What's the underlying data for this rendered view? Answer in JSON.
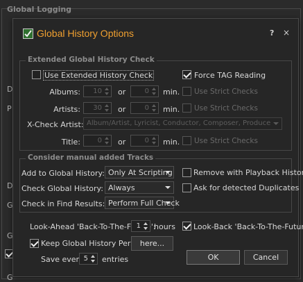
{
  "background": {
    "group1_title": "Global Logging",
    "side_letters": [
      "D",
      "P",
      "D",
      "G",
      "Gl",
      "G"
    ]
  },
  "dialog": {
    "title": "Global History Options",
    "help_glyph": "?",
    "close_glyph": "×",
    "icon": "checkmark-icon",
    "accent_color": "#f0a030"
  },
  "extended": {
    "group_title": "Extended Global History Check",
    "use_extended": {
      "label": "Use Extended History Check",
      "checked": false
    },
    "force_tag": {
      "label": "Force TAG Reading",
      "checked": true
    },
    "or_label": "or",
    "min_label": "min.",
    "rows": [
      {
        "label": "Albums:",
        "value_a": "10",
        "value_b": "0",
        "strict_label": "Use Strict Checks"
      },
      {
        "label": "Artists:",
        "value_a": "30",
        "value_b": "0",
        "strict_label": "Use Strict Checks"
      },
      {
        "label": "Title:",
        "value_a": "0",
        "value_b": "0",
        "strict_label": "Use Strict Checks"
      }
    ],
    "xcheck": {
      "label": "X-Check Artist:",
      "value": "Album/Artist, Lyricist, Conductor, Composer, Producer, Remixer"
    }
  },
  "manual": {
    "group_title": "Consider manual added Tracks",
    "add_to": {
      "label": "Add to Global History:",
      "value": "Only At Scripting"
    },
    "check": {
      "label": "Check Global History:",
      "value": "Always"
    },
    "find": {
      "label": "Check in Find Results:",
      "value": "Perform Full Check"
    },
    "remove_playback": {
      "label": "Remove with Playback History",
      "checked": false
    },
    "ask_duplicates": {
      "label": "Ask for detected Duplicates",
      "checked": false
    }
  },
  "bottom": {
    "lookahead_label": "Look-Ahead 'Back-To-The-Future':",
    "lookahead_value": "1",
    "hours_label": "hours",
    "lookback": {
      "label": "Look-Back 'Back-To-The-Future'",
      "checked": true
    },
    "keep_persistent": {
      "label": "Keep Global History Persistent",
      "checked": true
    },
    "here_button": "here...",
    "save_every_label": "Save every",
    "save_every_value": "5",
    "entries_label": "entries",
    "ok_button": "OK",
    "cancel_button": "Cancel"
  }
}
